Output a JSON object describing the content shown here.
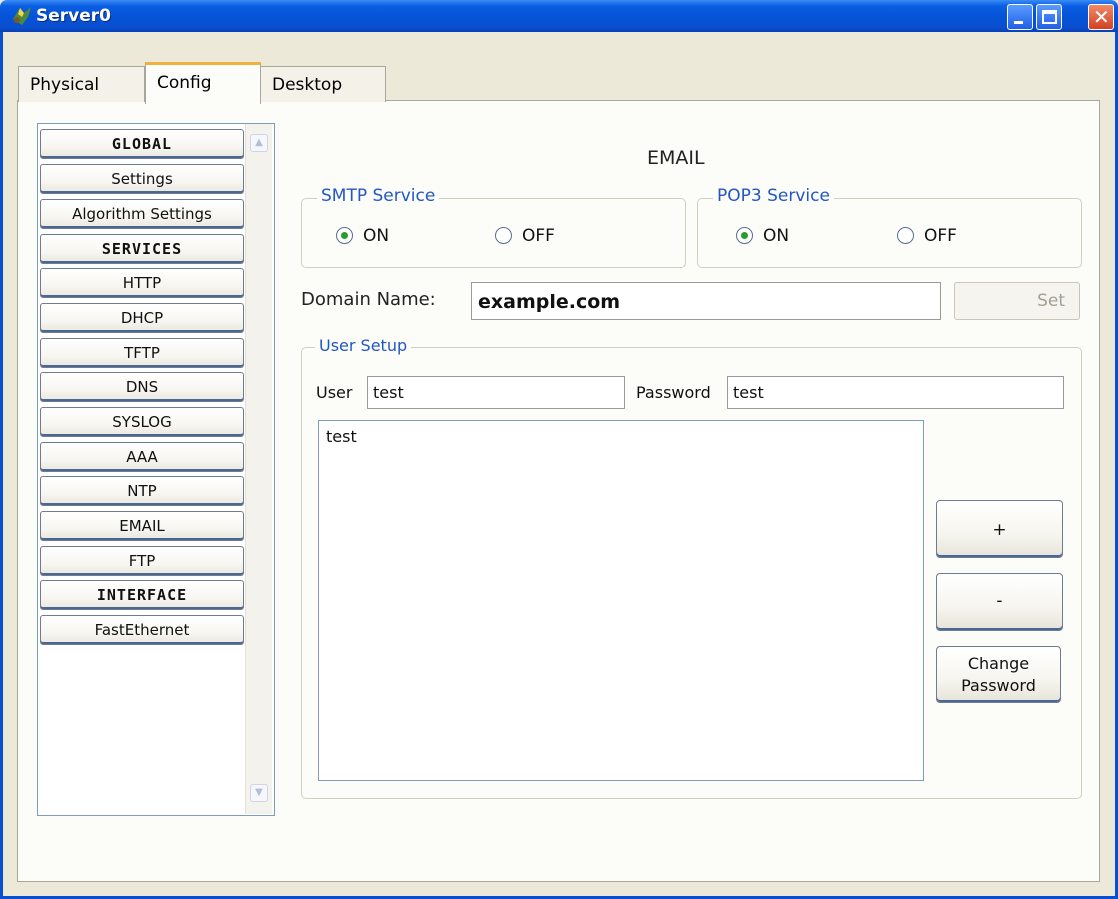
{
  "window": {
    "title": "Server0",
    "controls": [
      "minimize",
      "maximize",
      "close"
    ]
  },
  "tabs": [
    {
      "label": "Physical",
      "active": false
    },
    {
      "label": "Config",
      "active": true
    },
    {
      "label": "Desktop",
      "active": false
    }
  ],
  "sidebar": {
    "items": [
      {
        "label": "GLOBAL",
        "type": "header"
      },
      {
        "label": "Settings",
        "type": "item"
      },
      {
        "label": "Algorithm Settings",
        "type": "item"
      },
      {
        "label": "SERVICES",
        "type": "header"
      },
      {
        "label": "HTTP",
        "type": "item"
      },
      {
        "label": "DHCP",
        "type": "item"
      },
      {
        "label": "TFTP",
        "type": "item"
      },
      {
        "label": "DNS",
        "type": "item"
      },
      {
        "label": "SYSLOG",
        "type": "item"
      },
      {
        "label": "AAA",
        "type": "item"
      },
      {
        "label": "NTP",
        "type": "item"
      },
      {
        "label": "EMAIL",
        "type": "item"
      },
      {
        "label": "FTP",
        "type": "item"
      },
      {
        "label": "INTERFACE",
        "type": "header"
      },
      {
        "label": "FastEthernet",
        "type": "item"
      }
    ]
  },
  "email": {
    "title": "EMAIL",
    "smtp": {
      "legend": "SMTP Service",
      "on_label": "ON",
      "off_label": "OFF",
      "selected": "ON"
    },
    "pop3": {
      "legend": "POP3 Service",
      "on_label": "ON",
      "off_label": "OFF",
      "selected": "ON"
    },
    "domain": {
      "label": "Domain Name:",
      "value": "example.com",
      "set_label": "Set"
    },
    "user_setup": {
      "legend": "User Setup",
      "user_label": "User",
      "user_value": "test",
      "password_label": "Password",
      "password_value": "test",
      "users": [
        "test"
      ],
      "add_label": "+",
      "remove_label": "-",
      "change_password_label_1": "Change",
      "change_password_label_2": "Password"
    }
  },
  "colors": {
    "titlebar": "#0553d8",
    "legend_text": "#2256c4",
    "radio_selected": "#2c9b2c",
    "tab_active_accent": "#f2b13a"
  }
}
